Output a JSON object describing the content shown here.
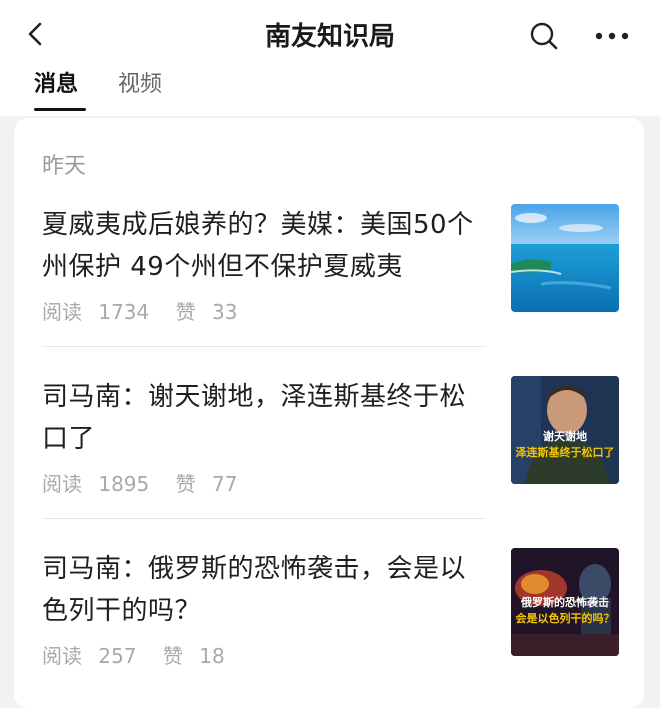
{
  "header": {
    "title": "南友知识局"
  },
  "tabs": [
    {
      "label": "消息",
      "active": true
    },
    {
      "label": "视频",
      "active": false
    }
  ],
  "feed": {
    "section_label": "昨天",
    "articles": [
      {
        "title": "夏威夷成后娘养的？美媒：美国50个州保护 49个州但不保护夏威夷",
        "reads_label": "阅读",
        "reads": "1734",
        "likes_label": "赞",
        "likes": "33",
        "thumb_caption": ""
      },
      {
        "title": "司马南：谢天谢地，泽连斯基终于松口了",
        "reads_label": "阅读",
        "reads": "1895",
        "likes_label": "赞",
        "likes": "77",
        "thumb_caption_line1": "谢天谢地",
        "thumb_caption_line2": "泽连斯基终于松口了"
      },
      {
        "title": "司马南：俄罗斯的恐怖袭击，会是以色列干的吗？",
        "reads_label": "阅读",
        "reads": "257",
        "likes_label": "赞",
        "likes": "18",
        "thumb_caption_line1": "俄罗斯的恐怖袭击",
        "thumb_caption_line2": "会是以色列干的吗？"
      }
    ]
  },
  "colors": {
    "accent_yellow": "#f2c500",
    "background": "#f2f2f2",
    "card": "#ffffff",
    "meta_text": "#a9a9a9"
  }
}
